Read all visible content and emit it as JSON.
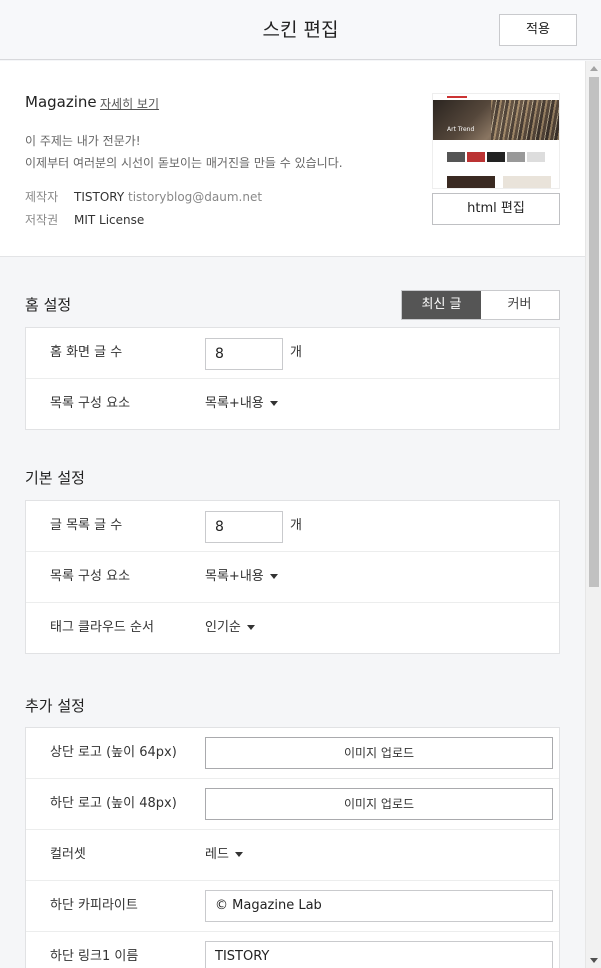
{
  "header": {
    "title": "스킨 편집",
    "apply_label": "적용"
  },
  "skin": {
    "name": "Magazine",
    "detail_link": "자세히 보기",
    "desc_line1": "이 주제는 내가 전문가!",
    "desc_line2": "이제부터 여러분의 시선이 돋보이는 매거진을 만들 수 있습니다.",
    "maker_key": "제작자",
    "maker_value": "TISTORY",
    "maker_email": "tistoryblog@daum.net",
    "license_key": "저작권",
    "license_value": "MIT License",
    "thumbnail_caption": "Art Trend",
    "html_edit_label": "html 편집"
  },
  "home_settings": {
    "title": "홈 설정",
    "toggle_on": "최신 글",
    "toggle_off": "커버",
    "posts_label": "홈 화면 글 수",
    "posts_value": "8",
    "posts_unit": "개",
    "list_label": "목록 구성 요소",
    "list_value": "목록+내용"
  },
  "basic_settings": {
    "title": "기본 설정",
    "posts_label": "글 목록 글 수",
    "posts_value": "8",
    "posts_unit": "개",
    "list_label": "목록 구성 요소",
    "list_value": "목록+내용",
    "tag_label": "태그 클라우드 순서",
    "tag_value": "인기순"
  },
  "extra_settings": {
    "title": "추가 설정",
    "top_logo_label": "상단 로고 (높이 64px)",
    "top_logo_button": "이미지 업로드",
    "bottom_logo_label": "하단 로고 (높이 48px)",
    "bottom_logo_button": "이미지 업로드",
    "colorset_label": "컬러셋",
    "colorset_value": "레드",
    "copyright_label": "하단 카피라이트",
    "copyright_value": "© Magazine Lab",
    "link1_label": "하단 링크1 이름",
    "link1_value": "TISTORY"
  }
}
